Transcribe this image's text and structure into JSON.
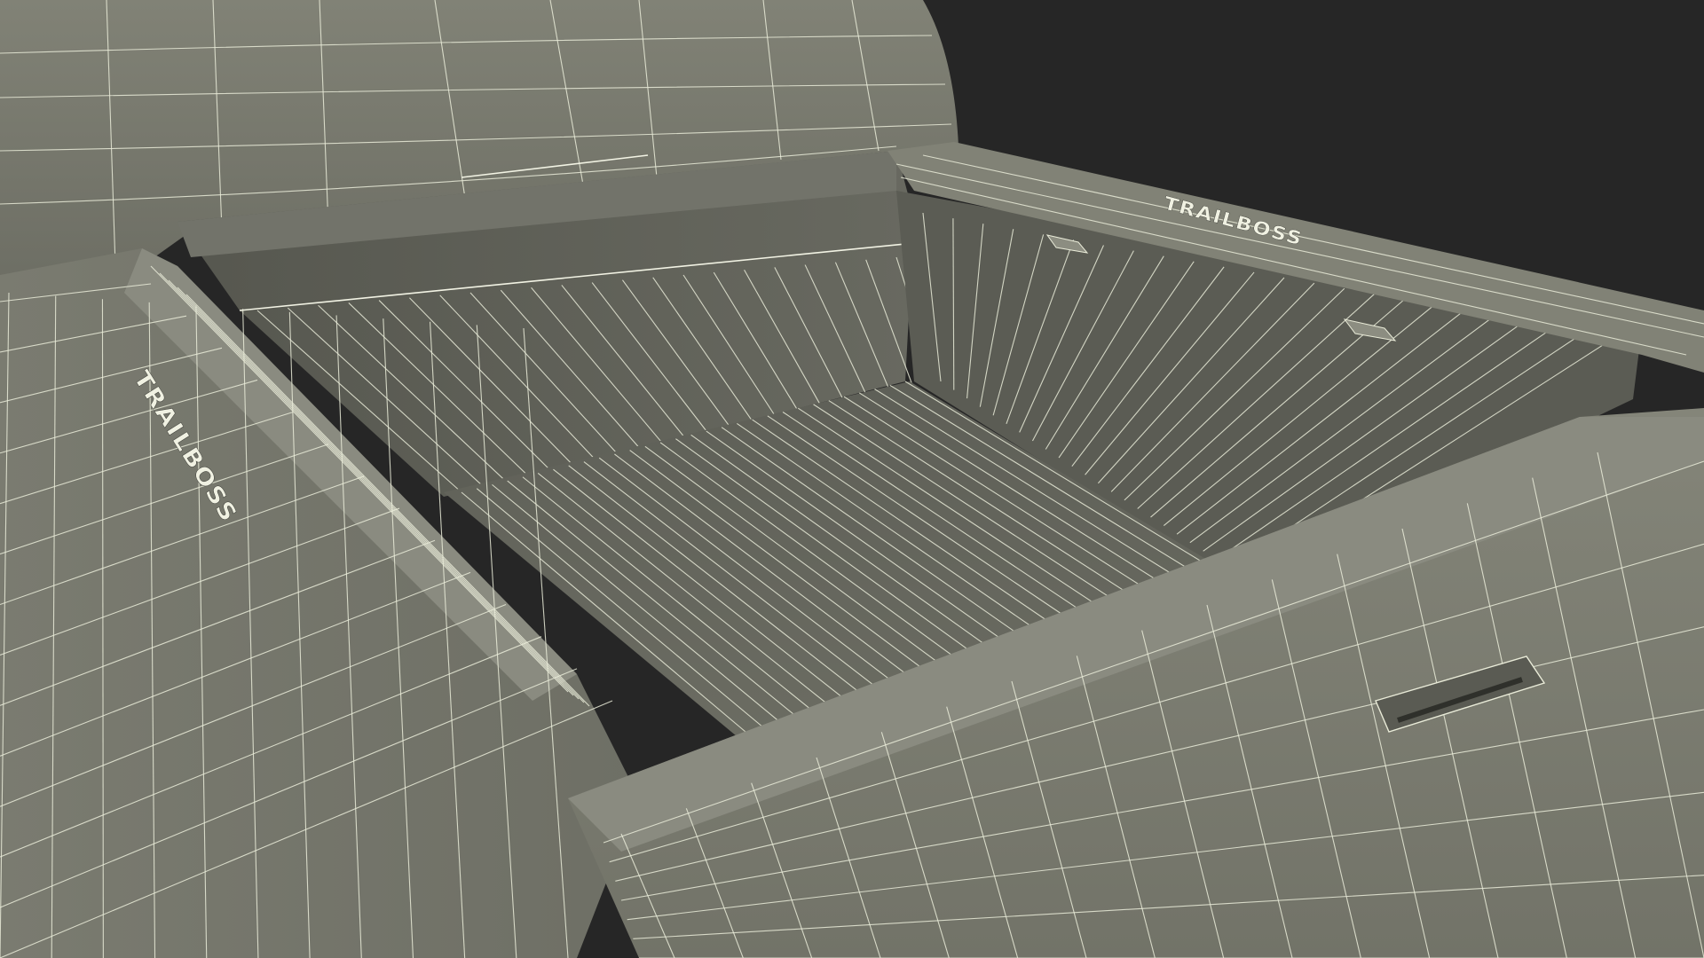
{
  "scene": {
    "subject": "pickup-truck-bed-wireframe",
    "render_mode": "shaded-wireframe",
    "colors": {
      "background": "#262626",
      "surface_light": "#7c7d72",
      "surface_mid": "#6c6d63",
      "surface_dark": "#55564e",
      "bed_floor": "#66675e",
      "wire": "#e9ebd8"
    },
    "decals": {
      "left_rail": "TRAILBOSS",
      "right_rail": "TRAILBOSS"
    }
  }
}
